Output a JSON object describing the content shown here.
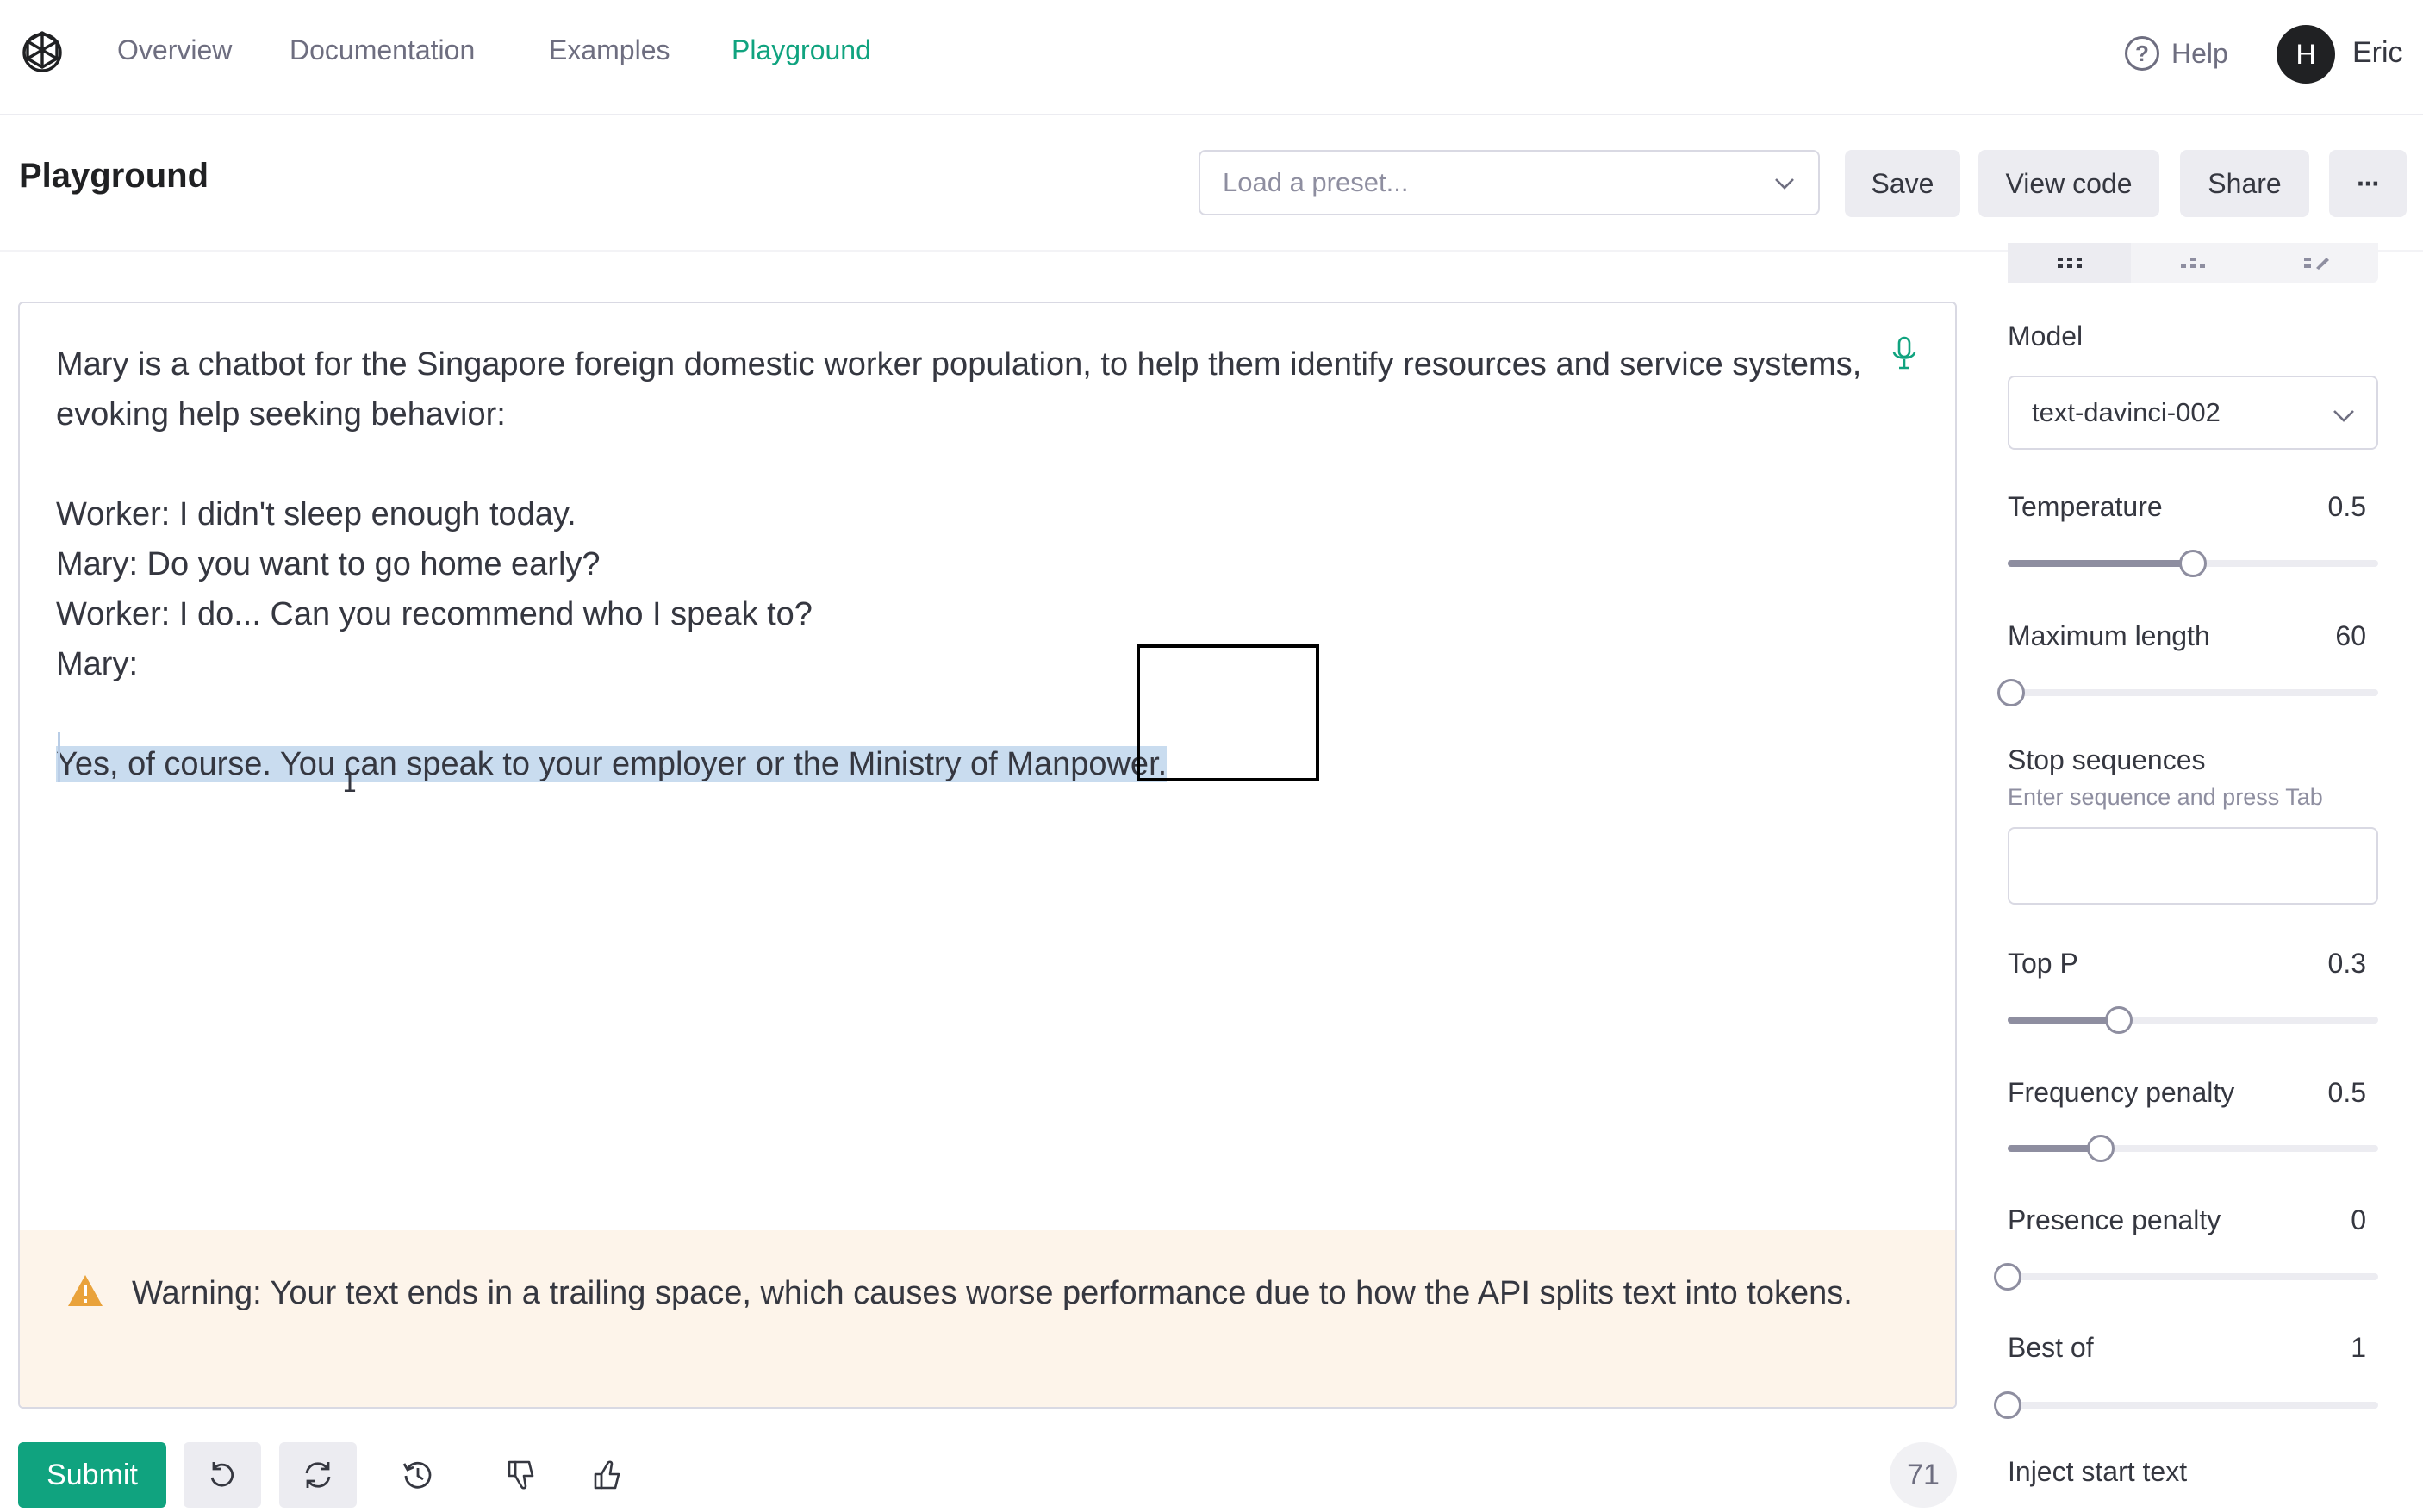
{
  "nav": {
    "links": [
      "Overview",
      "Documentation",
      "Examples",
      "Playground"
    ],
    "active": "Playground",
    "help_label": "Help",
    "user_initial": "H",
    "user_name": "Eric"
  },
  "header": {
    "title": "Playground",
    "preset_placeholder": "Load a preset...",
    "save_label": "Save",
    "view_code_label": "View code",
    "share_label": "Share",
    "more_label": "···"
  },
  "editor": {
    "lines": [
      "Mary is a chatbot for the Singapore foreign domestic worker population, to help them identify resources and service systems, evoking help seeking behavior:",
      "",
      "Worker: I didn't sleep enough today.",
      "Mary: Do you want to go home early?",
      "Worker: I do... Can you recommend who I speak to?",
      "Mary:",
      ""
    ],
    "completion": "Yes, of course. You can speak to your employer or the Ministry of Manpower.",
    "warning": "Warning: Your text ends in a trailing space, which causes worse performance due to how the API splits text into tokens."
  },
  "bottom": {
    "submit_label": "Submit",
    "token_count": "71"
  },
  "sidebar": {
    "model_label": "Model",
    "model_value": "text-davinci-002",
    "temperature": {
      "label": "Temperature",
      "value": "0.5",
      "fraction": 0.5
    },
    "max_length": {
      "label": "Maximum length",
      "value": "60",
      "fraction": 0.01
    },
    "stop_sequences": {
      "label": "Stop sequences",
      "hint": "Enter sequence and press Tab"
    },
    "top_p": {
      "label": "Top P",
      "value": "0.3",
      "fraction": 0.3
    },
    "frequency_penalty": {
      "label": "Frequency penalty",
      "value": "0.5",
      "fraction": 0.25
    },
    "presence_penalty": {
      "label": "Presence penalty",
      "value": "0",
      "fraction": 0
    },
    "best_of": {
      "label": "Best of",
      "value": "1",
      "fraction": 0
    },
    "inject_start_label": "Inject start text"
  },
  "colors": {
    "accent": "#10a37f",
    "selection": "#c9dcef",
    "warning_bg": "#fdf4ea",
    "warning_icon": "#e9a23b"
  }
}
